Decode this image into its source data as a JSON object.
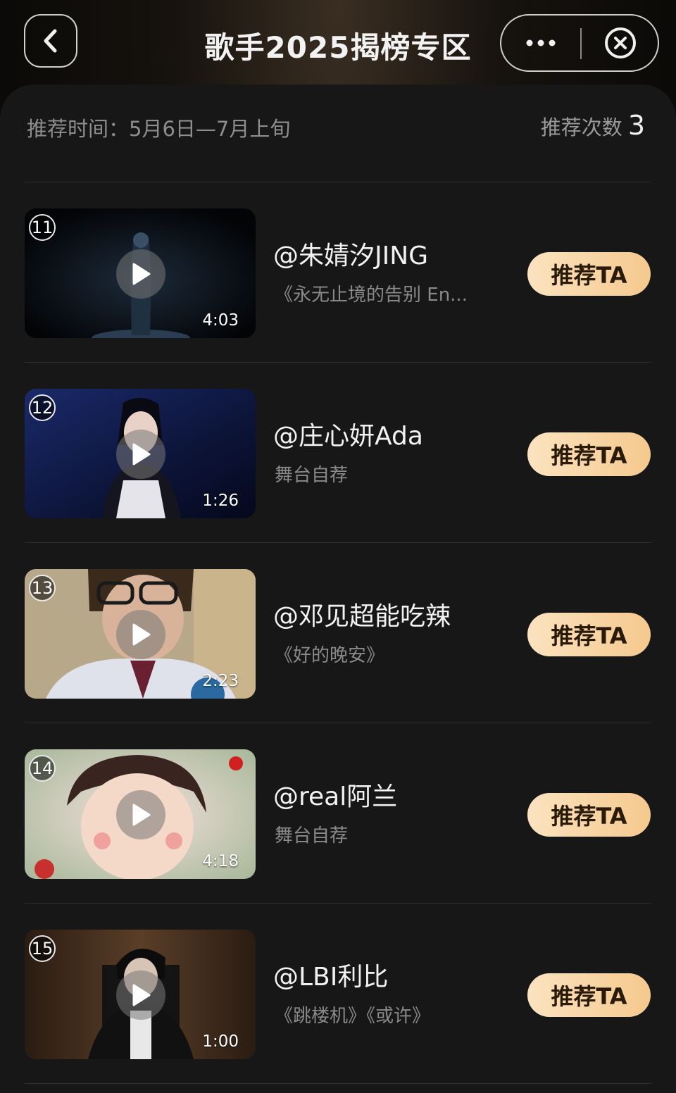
{
  "header": {
    "title": "歌手2025揭榜专区"
  },
  "info": {
    "time_label": "推荐时间：5月6日—7月上旬",
    "count_label": "推荐次数",
    "count_value": "3"
  },
  "button_label": "推荐TA",
  "items": [
    {
      "rank": "11",
      "name": "@朱婧汐JING",
      "sub": "《永无止境的告别 En...",
      "duration": "4:03"
    },
    {
      "rank": "12",
      "name": "@庄心妍Ada",
      "sub": "舞台自荐",
      "duration": "1:26"
    },
    {
      "rank": "13",
      "name": "@邓见超能吃辣",
      "sub": "《好的晚安》",
      "duration": "2:23"
    },
    {
      "rank": "14",
      "name": "@real阿兰",
      "sub": "舞台自荐",
      "duration": "4:18"
    },
    {
      "rank": "15",
      "name": "@LBI利比",
      "sub": "《跳楼机》《或许》",
      "duration": "1:00"
    }
  ]
}
